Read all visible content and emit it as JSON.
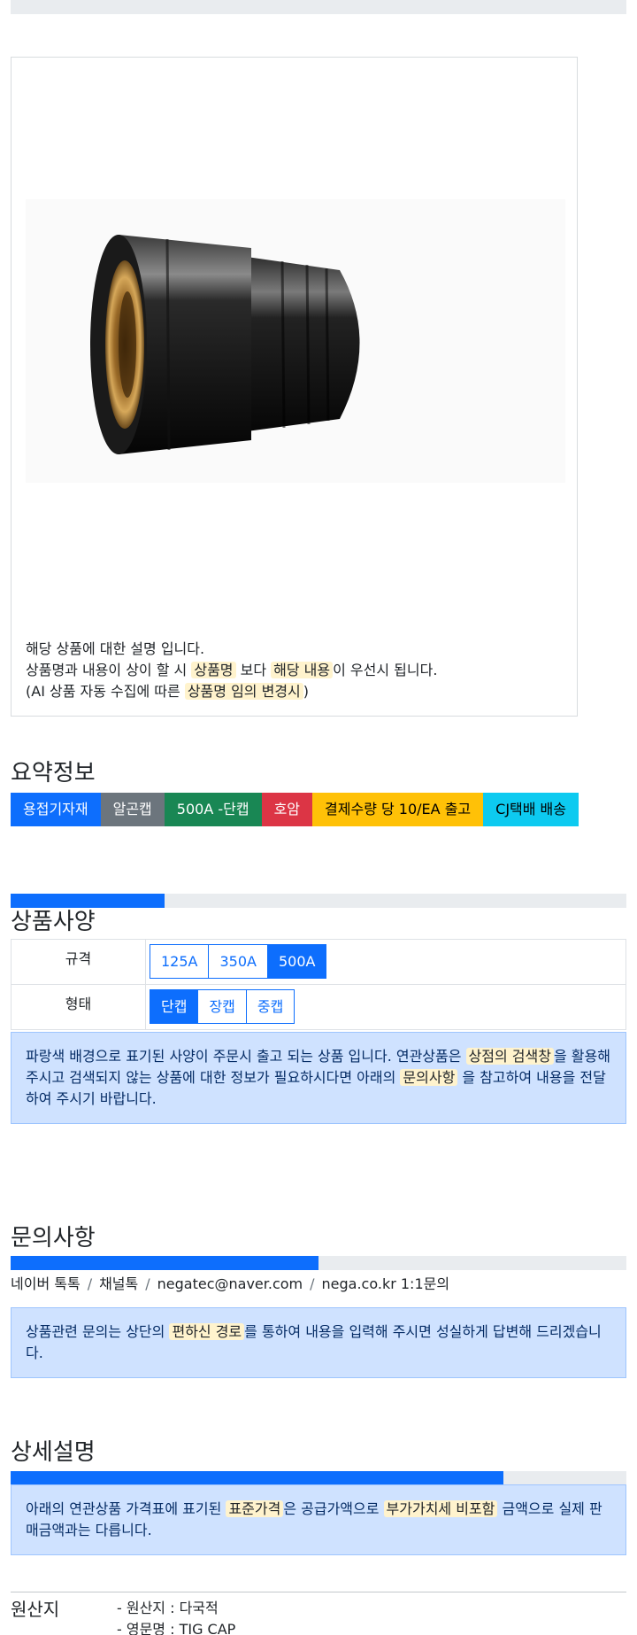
{
  "colors": {
    "primary": "#0d6efd",
    "secondary": "#6c757d",
    "success": "#198754",
    "danger": "#dc3545",
    "warning": "#ffc107",
    "info": "#0dcaf0",
    "alert_bg": "#cfe2ff",
    "highlight": "#fff3cd"
  },
  "product": {
    "image_icon": "black-tig-cap-photo",
    "description": {
      "line1": "해당 상품에 대한 설명 입니다.",
      "line2_a": "상품명과 내용이 상이 할 시 ",
      "line2_mark1": "상품명",
      "line2_b": " 보다 ",
      "line2_mark2": "해당 내용",
      "line2_c": "이 우선시 됩니다.",
      "line3_a": "(AI 상품 자동 수집에 따른 ",
      "line3_mark": "상품명 임의 변경시",
      "line3_b": ")"
    }
  },
  "summary": {
    "title": "요약정보",
    "badges": [
      "용접기자재",
      "알곤캡",
      "500A -단캡",
      "호암",
      "결제수량 당 10/EA 출고",
      "CJ택배 배송"
    ]
  },
  "spec": {
    "title": "상품사양",
    "progress_fraction": 0.25,
    "rows": [
      {
        "label": "규격",
        "options": [
          "125A",
          "350A",
          "500A"
        ],
        "selected": 2
      },
      {
        "label": "형태",
        "options": [
          "단캡",
          "장캡",
          "중캡"
        ],
        "selected": 0
      }
    ],
    "notice": {
      "a": "파랑색 배경으로 표기된 사양이 주문시 출고 되는 상품 입니다. 연관상품은 ",
      "mark1": "상점의 검색창",
      "b": "을 활용해 주시고 검색되지 않는 상품에 대한 정보가 필요하시다면 아래의 ",
      "mark2": "문의사항",
      "c": " 을 참고하여 내용을 전달하여 주시기 바랍니다."
    }
  },
  "inquiry": {
    "title": "문의사항",
    "progress_fraction": 0.5,
    "channels": [
      "네이버 톡톡",
      "채널톡",
      "negatec@naver.com",
      "nega.co.kr 1:1문의"
    ],
    "separator": "/",
    "notice": {
      "a": "상품관련 문의는 상단의 ",
      "mark": "편하신 경로",
      "b": "를 통하여 내용을 입력해 주시면 성실하게 답변해 드리겠습니다."
    }
  },
  "detail": {
    "title": "상세설명",
    "progress_fraction": 0.8,
    "notice": {
      "a": "아래의 연관상품 가격표에 표기된 ",
      "mark1": "표준가격",
      "b": "은 공급가액으로 ",
      "mark2": "부가가치세 비포함",
      "c": " 금액으로 실제 판매금액과는 다릅니다."
    }
  },
  "origin": {
    "title": "원산지",
    "items": [
      "- 원산지 : 다국적",
      "- 영문명 : TIG CAP"
    ]
  }
}
